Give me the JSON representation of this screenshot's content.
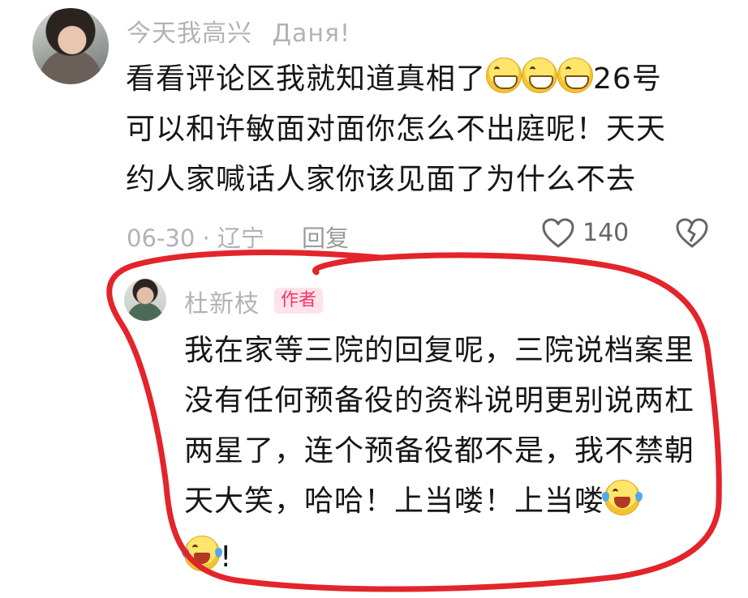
{
  "comment": {
    "author": "今天我高兴",
    "author_suffix": "Даня!",
    "lines": [
      {
        "a": "看看评论区我就知道真相了",
        "b": "26号"
      },
      "可以和许敏面对面你怎么不出庭呢！天天",
      "约人家喊话人家你该见面了为什么不去"
    ],
    "date_location": "06-30 · 辽宁",
    "reply_label": "回复",
    "like_count": "140",
    "like_icon": "heart-outline-icon",
    "dislike_icon": "broken-heart-icon"
  },
  "reply": {
    "author": "杜新枝",
    "badge": "作者",
    "lines": [
      "我在家等三院的回复呢，三院说档案里",
      "没有任何预备役的资料说明更别说两杠",
      "两星了，连个预备役都不是，我不禁朝",
      "天大笑，哈哈！上当喽！上当喽",
      "!"
    ]
  },
  "annotation": {
    "color": "#e3242b"
  }
}
